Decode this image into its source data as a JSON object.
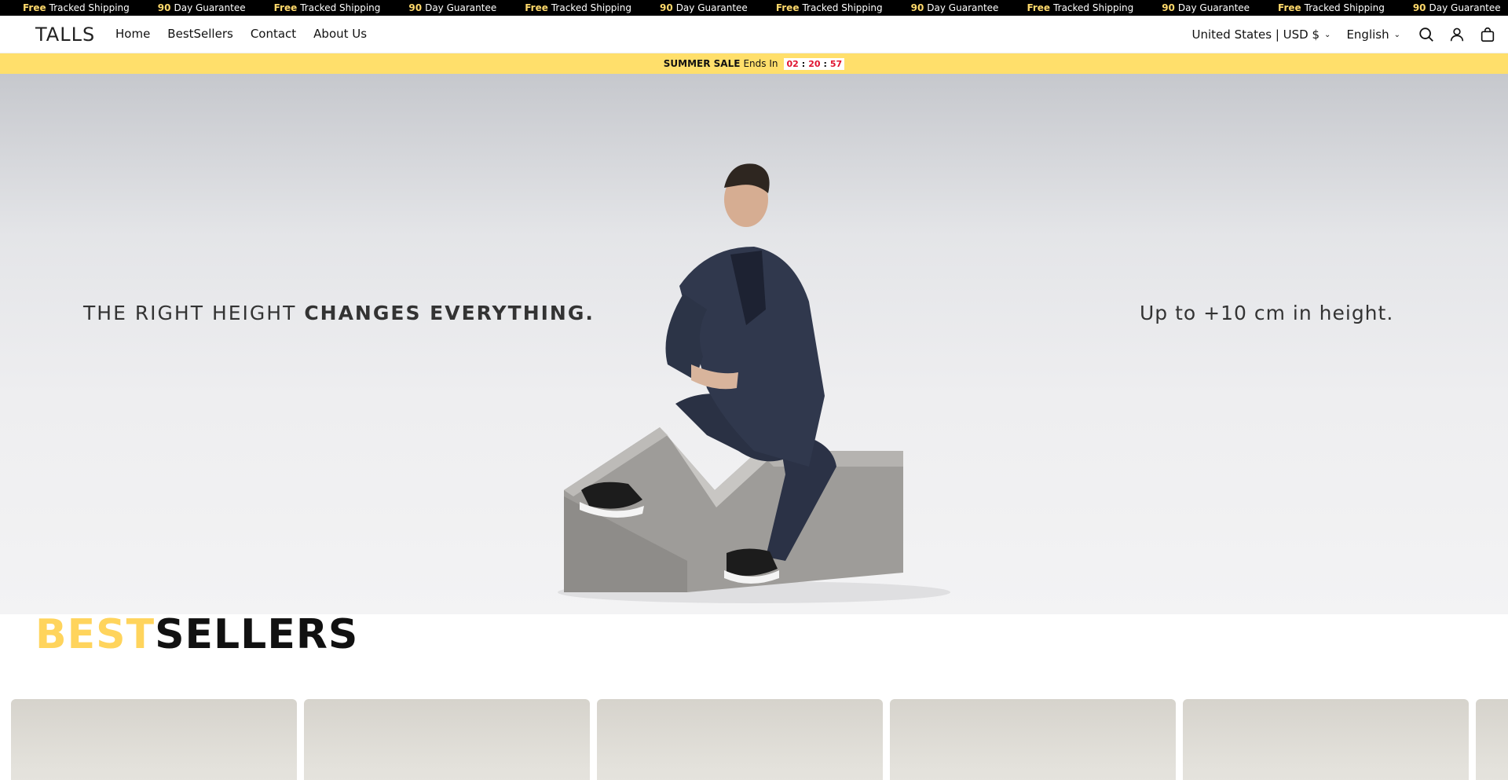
{
  "marquee": {
    "items": [
      {
        "highlight": "Free",
        "text": "Tracked Shipping"
      },
      {
        "highlight": "90",
        "text": "Day Guarantee"
      },
      {
        "highlight": "Free",
        "text": "Tracked Shipping"
      },
      {
        "highlight": "90",
        "text": "Day Guarantee"
      },
      {
        "highlight": "Free",
        "text": "Tracked Shipping"
      },
      {
        "highlight": "90",
        "text": "Day Guarantee"
      },
      {
        "highlight": "Free",
        "text": "Tracked Shipping"
      },
      {
        "highlight": "90",
        "text": "Day Guarantee"
      },
      {
        "highlight": "Free",
        "text": "Tracked Shipping"
      },
      {
        "highlight": "90",
        "text": "Day Guarantee"
      },
      {
        "highlight": "Free",
        "text": "Tracked Shipping"
      },
      {
        "highlight": "90",
        "text": "Day Guarantee"
      }
    ]
  },
  "header": {
    "logo": "TALLS",
    "nav": [
      "Home",
      "BestSellers",
      "Contact",
      "About Us"
    ],
    "country": "United States | USD $",
    "language": "English",
    "icons": [
      "search-icon",
      "account-icon",
      "cart-icon"
    ]
  },
  "salebar": {
    "label": "SUMMER SALE",
    "ends": "Ends In",
    "hours": "02",
    "minutes": "20",
    "seconds": "57"
  },
  "hero": {
    "tagline_light": "THE RIGHT HEIGHT",
    "tagline_bold": "CHANGES EVERYTHING.",
    "right_text": "Up to +10 cm in height."
  },
  "bestsellers": {
    "title_accent": "BEST",
    "title_rest": "SELLERS"
  },
  "colors": {
    "accent": "#ffd45c",
    "salebar": "#ffdf6b",
    "timer": "#e0132e"
  }
}
